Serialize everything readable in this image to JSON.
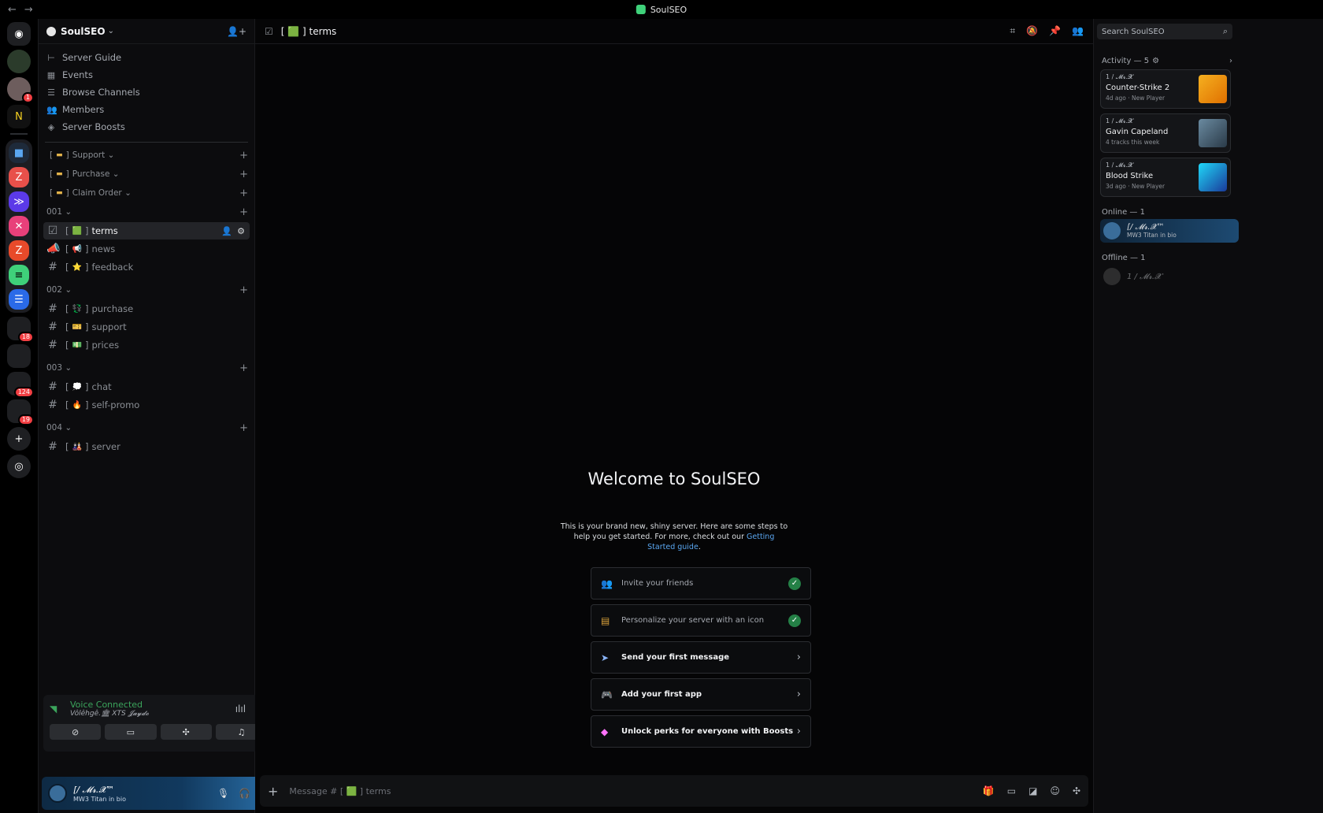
{
  "window": {
    "title": "SoulSEO"
  },
  "rail": {
    "badges": [
      "1",
      "18",
      "124",
      "19"
    ]
  },
  "server": {
    "name": "SoulSEO",
    "nav": [
      {
        "label": "Server Guide",
        "icon": "signpost-icon"
      },
      {
        "label": "Events",
        "icon": "calendar-icon"
      },
      {
        "label": "Browse Channels",
        "icon": "list-icon"
      },
      {
        "label": "Members",
        "icon": "members-icon"
      },
      {
        "label": "Server Boosts",
        "icon": "boost-icon"
      }
    ],
    "top_categories": [
      "Support",
      "Purchase",
      "Claim Order"
    ],
    "categories": [
      {
        "name": "001",
        "channels": [
          {
            "name": "terms",
            "emoji": "🟩",
            "icon": "rules-icon",
            "active": true
          },
          {
            "name": "news",
            "emoji": "📢",
            "icon": "announcement-icon"
          },
          {
            "name": "feedback",
            "emoji": "⭐",
            "icon": "hash-icon"
          }
        ]
      },
      {
        "name": "002",
        "channels": [
          {
            "name": "purchase",
            "emoji": "💱",
            "icon": "hash-icon"
          },
          {
            "name": "support",
            "emoji": "🎫",
            "icon": "hash-icon"
          },
          {
            "name": "prices",
            "emoji": "💵",
            "icon": "hash-icon"
          }
        ]
      },
      {
        "name": "003",
        "channels": [
          {
            "name": "chat",
            "emoji": "💭",
            "icon": "hash-icon"
          },
          {
            "name": "self-promo",
            "emoji": "🔥",
            "icon": "hash-icon"
          }
        ]
      },
      {
        "name": "004",
        "channels": [
          {
            "name": "server",
            "emoji": "🎎",
            "icon": "hash-icon"
          }
        ]
      }
    ]
  },
  "voice": {
    "status": "Voice Connected",
    "channel": "Vôlêhgê.🏛 XTS 𝓙𝓪𝔂𝓭𝓸"
  },
  "user": {
    "name": "[/ 𝓜𝓻.𝓧™",
    "status": "MW3 Titan in bio"
  },
  "channel_header": {
    "title": "[ 🟩 ] terms"
  },
  "welcome": {
    "title": "Welcome to SoulSEO",
    "desc": "This is your brand new, shiny server. Here are some steps to help you get started. For more, check out our",
    "link": "Getting Started guide",
    "end": ".",
    "steps": [
      {
        "label": "Invite your friends",
        "done": true
      },
      {
        "label": "Personalize your server with an icon",
        "done": true
      },
      {
        "label": "Send your first message",
        "done": false
      },
      {
        "label": "Add your first app",
        "done": false
      },
      {
        "label": "Unlock perks for everyone with Boosts",
        "done": false
      }
    ]
  },
  "composer": {
    "placeholder": "Message # [ 🟩 ] terms"
  },
  "right": {
    "search_placeholder": "Search SoulSEO",
    "activity_label": "Activity — 5",
    "cards": [
      {
        "who": "1 / 𝓜𝓻.𝓧",
        "game": "Counter-Strike 2",
        "meta": "4d ago · New Player",
        "color": "#f0a020"
      },
      {
        "who": "1 / 𝓜𝓻.𝓧",
        "game": "Gavin Capeland",
        "meta": "4 tracks this week",
        "color": "#4c6a80"
      },
      {
        "who": "1 / 𝓜𝓻.𝓧",
        "game": "Blood Strike",
        "meta": "3d ago · New Player",
        "color": "#1fb8d8"
      }
    ],
    "online_label": "Online — 1",
    "online_member": {
      "name": "[/ 𝓜𝓻.𝓧™",
      "status": "MW3 Titan in bio"
    },
    "offline_label": "Offline — 1",
    "offline_member": {
      "name": "1 / 𝓜𝓻.𝓧"
    }
  }
}
